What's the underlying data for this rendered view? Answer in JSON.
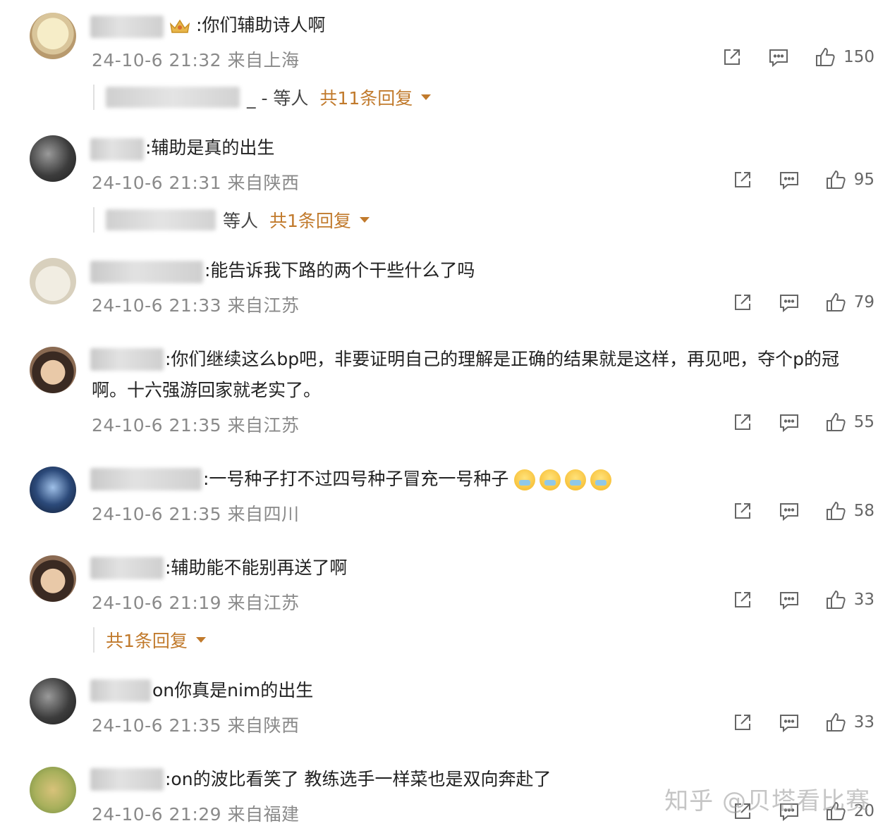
{
  "comments": [
    {
      "text": ":你们辅助诗人啊",
      "meta": "24-10-6 21:32 来自上海",
      "likes": "150",
      "reply": {
        "tail": "_ - 等人",
        "count": "共11条回复"
      }
    },
    {
      "text": ":辅助是真的出生",
      "meta": "24-10-6 21:31 来自陕西",
      "likes": "95",
      "reply": {
        "tail": "等人",
        "count": "共1条回复"
      }
    },
    {
      "text": ":能告诉我下路的两个干些什么了吗",
      "meta": "24-10-6 21:33 来自江苏",
      "likes": "79"
    },
    {
      "text": ":你们继续这么bp吧，非要证明自己的理解是正确的结果就是这样，再见吧，夺个p的冠啊。十六强游回家就老实了。",
      "meta": "24-10-6 21:35 来自江苏",
      "likes": "55"
    },
    {
      "text": ":一号种子打不过四号种子冒充一号种子",
      "meta": "24-10-6 21:35 来自四川",
      "likes": "58"
    },
    {
      "text": ":辅助能不能别再送了啊",
      "meta": "24-10-6 21:19 来自江苏",
      "likes": "33",
      "reply": {
        "tail": "",
        "count": "共1条回复"
      }
    },
    {
      "text": "on你真是nim的出生",
      "meta": "24-10-6 21:35 来自陕西",
      "likes": "33"
    },
    {
      "text": ":on的波比看笑了 教练选手一样菜也是双向奔赴了",
      "meta": "24-10-6 21:29 来自福建",
      "likes": "20"
    }
  ],
  "watermark": "知乎 @贝塔看比赛",
  "colors": {
    "reply_accent": "#c17a2c",
    "meta_gray": "#8a8a8a"
  }
}
